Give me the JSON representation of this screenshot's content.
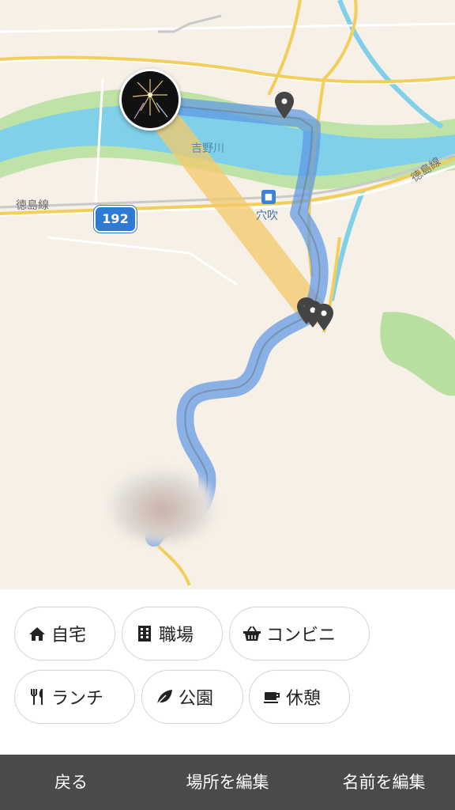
{
  "map": {
    "labels": {
      "river": "吉野川",
      "line_left": "徳島線",
      "line_right": "徳島線",
      "station": "穴吹",
      "highway": "192"
    }
  },
  "chips": [
    {
      "label": "自宅",
      "icon": "home-icon"
    },
    {
      "label": "職場",
      "icon": "building-icon"
    },
    {
      "label": "コンビニ",
      "icon": "basket-icon"
    },
    {
      "label": "ランチ",
      "icon": "fork-knife-icon"
    },
    {
      "label": "公園",
      "icon": "leaf-icon"
    },
    {
      "label": "休憩",
      "icon": "coffee-cup-icon"
    }
  ],
  "bottom_bar": {
    "back": "戻る",
    "edit_place": "場所を編集",
    "edit_name": "名前を編集"
  },
  "colors": {
    "route": "#5b95e6",
    "highlight_route": "#f3c96a",
    "river": "#7fd0e8",
    "bottom_bar": "#4a4a4a"
  }
}
